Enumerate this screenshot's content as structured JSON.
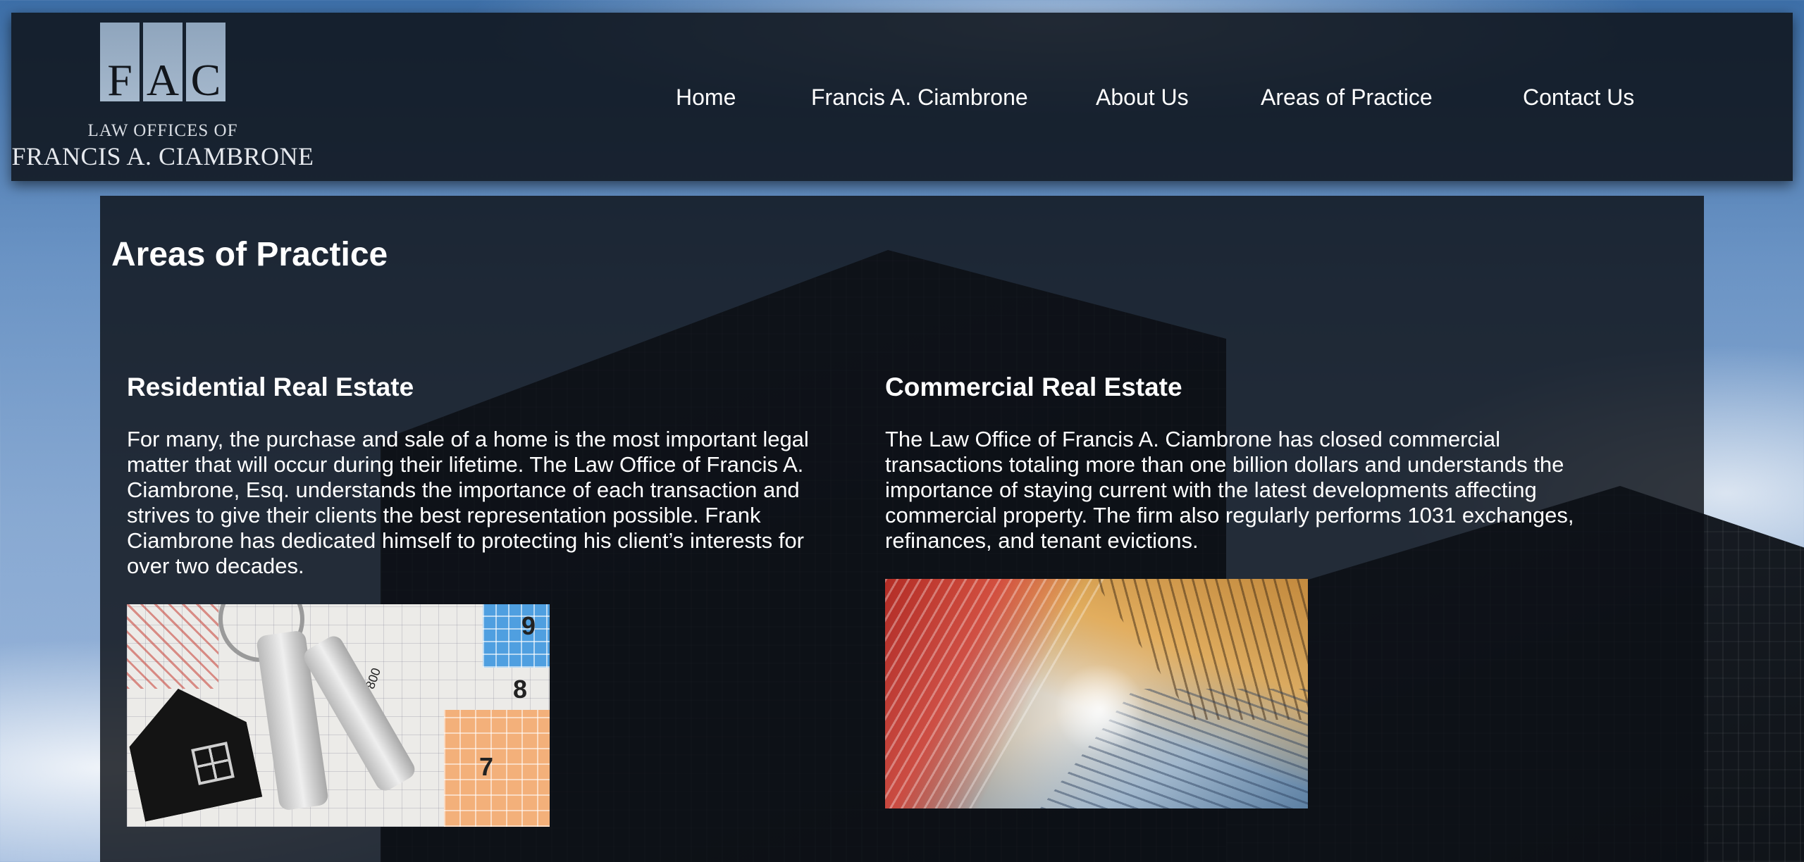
{
  "site": {
    "logo_letters": [
      "F",
      "A",
      "C"
    ],
    "logo_line1": "LAW OFFICES OF",
    "logo_line2": "FRANCIS A. CIAMBRONE"
  },
  "nav": {
    "items": [
      {
        "label": "Home"
      },
      {
        "label": "Francis A. Ciambrone"
      },
      {
        "label": "About Us"
      },
      {
        "label": "Areas of Practice"
      },
      {
        "label": "Contact Us"
      }
    ]
  },
  "main": {
    "title": "Areas of Practice",
    "sections": [
      {
        "heading": "Residential Real Estate",
        "body": "For many, the purchase and sale of a home is the most important legal matter that will occur during their lifetime. The Law Office of Francis A. Ciambrone, Esq. understands the importance of each transaction and strives to give their clients the best representation possible. Frank Ciambrone has dedicated himself to protecting his client’s interests for over two decades."
      },
      {
        "heading": "Commercial Real Estate",
        "body": "The Law Office of Francis A. Ciambrone has closed commercial transactions totaling more than one billion dollars and understands the importance of staying current with the latest developments affecting commercial property. The firm also regularly performs 1031 exchanges, refinances, and tenant evictions."
      }
    ],
    "keys_image_numbers": [
      "9",
      "8",
      "7",
      "800"
    ]
  },
  "colors": {
    "header_bg": "#0f141c",
    "panel_bg": "#0c1016",
    "text": "#ffffff",
    "logo_block": "#a5b8cc"
  }
}
